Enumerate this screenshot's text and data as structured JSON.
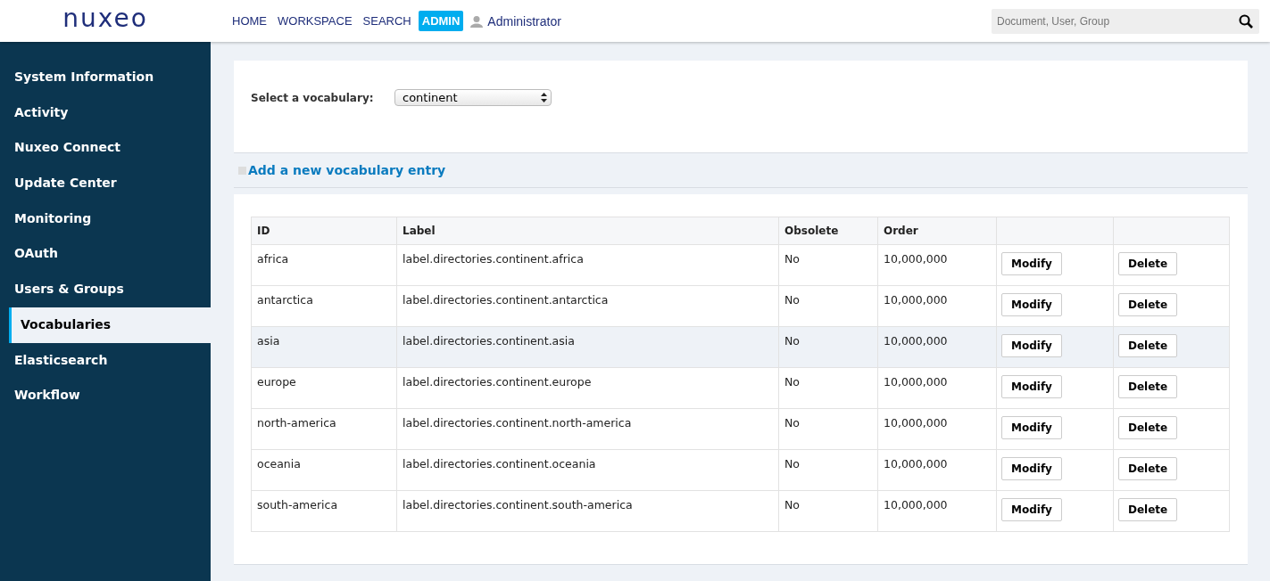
{
  "header": {
    "logo": "nuxeo",
    "nav": [
      {
        "label": "HOME",
        "selected": false
      },
      {
        "label": "WORKSPACE",
        "selected": false
      },
      {
        "label": "SEARCH",
        "selected": false
      },
      {
        "label": "ADMIN",
        "selected": true
      }
    ],
    "user": "Administrator",
    "search": {
      "placeholder": "Document, User, Group"
    }
  },
  "sidebar": {
    "items": [
      {
        "label": "System Information",
        "selected": false
      },
      {
        "label": "Activity",
        "selected": false
      },
      {
        "label": "Nuxeo Connect",
        "selected": false
      },
      {
        "label": "Update Center",
        "selected": false
      },
      {
        "label": "Monitoring",
        "selected": false
      },
      {
        "label": "OAuth",
        "selected": false
      },
      {
        "label": "Users & Groups",
        "selected": false
      },
      {
        "label": "Vocabularies",
        "selected": true
      },
      {
        "label": "Elasticsearch",
        "selected": false
      },
      {
        "label": "Workflow",
        "selected": false
      }
    ]
  },
  "vocabulary_select": {
    "label": "Select a vocabulary:",
    "value": "continent"
  },
  "add_entry_link": "Add a new vocabulary entry",
  "table": {
    "columns": [
      "ID",
      "Label",
      "Obsolete",
      "Order",
      "",
      ""
    ],
    "rows": [
      {
        "id": "africa",
        "label": "label.directories.continent.africa",
        "obsolete": "No",
        "order": "10,000,000",
        "modify": "Modify",
        "delete": "Delete",
        "selected": false
      },
      {
        "id": "antarctica",
        "label": "label.directories.continent.antarctica",
        "obsolete": "No",
        "order": "10,000,000",
        "modify": "Modify",
        "delete": "Delete",
        "selected": false
      },
      {
        "id": "asia",
        "label": "label.directories.continent.asia",
        "obsolete": "No",
        "order": "10,000,000",
        "modify": "Modify",
        "delete": "Delete",
        "selected": true
      },
      {
        "id": "europe",
        "label": "label.directories.continent.europe",
        "obsolete": "No",
        "order": "10,000,000",
        "modify": "Modify",
        "delete": "Delete",
        "selected": false
      },
      {
        "id": "north-america",
        "label": "label.directories.continent.north-america",
        "obsolete": "No",
        "order": "10,000,000",
        "modify": "Modify",
        "delete": "Delete",
        "selected": false
      },
      {
        "id": "oceania",
        "label": "label.directories.continent.oceania",
        "obsolete": "No",
        "order": "10,000,000",
        "modify": "Modify",
        "delete": "Delete",
        "selected": false
      },
      {
        "id": "south-america",
        "label": "label.directories.continent.south-america",
        "obsolete": "No",
        "order": "10,000,000",
        "modify": "Modify",
        "delete": "Delete",
        "selected": false
      }
    ]
  }
}
